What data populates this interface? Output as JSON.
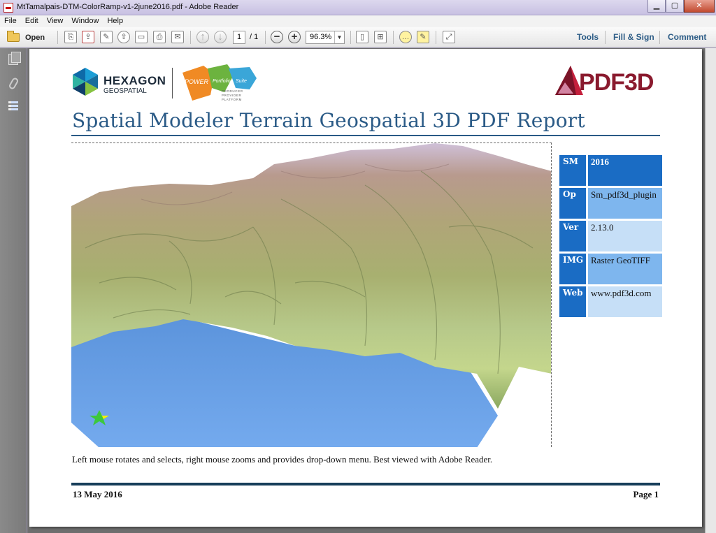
{
  "window": {
    "title": "MtTamalpais-DTM-ColorRamp-v1-2june2016.pdf - Adobe Reader",
    "minimize": "▁",
    "maximize": "▢",
    "close": "✕"
  },
  "menu": [
    "File",
    "Edit",
    "View",
    "Window",
    "Help"
  ],
  "toolbar": {
    "open_label": "Open",
    "page_current": "1",
    "page_total": "/ 1",
    "zoom_value": "96.3%",
    "zoom_arrow": "▼",
    "zoom_out": "−",
    "zoom_in": "+",
    "tools": "Tools",
    "fill_sign": "Fill & Sign",
    "comment": "Comment"
  },
  "logos": {
    "hexagon_word": "HEXAGON",
    "hexagon_sub": "GEOSPATIAL",
    "power_word": "POWER",
    "portfolio_word": "Portfolio",
    "suite_word": "Suite",
    "power_sub": [
      "PRODUCER",
      "PROVIDER",
      "PLATFORM"
    ],
    "pdf3d_word": "PDF3D"
  },
  "report": {
    "title": "Spatial Modeler Terrain Geospatial 3D PDF Report",
    "instructions": "Left mouse rotates and selects, right mouse zooms and provides drop-down menu. Best viewed with Adobe Reader.",
    "date": "13 May 2016",
    "page_label": "Page 1"
  },
  "info_table": [
    {
      "key": "SM",
      "value": "2016"
    },
    {
      "key": "Op",
      "value": "Sm_pdf3d_plugin"
    },
    {
      "key": "Ver",
      "value": "2.13.0"
    },
    {
      "key": "IMG",
      "value": "Raster GeoTIFF"
    },
    {
      "key": "Web",
      "value": "www.pdf3d.com"
    }
  ],
  "colors": {
    "title_blue": "#2a5a86",
    "table_dark": "#1a6cc4",
    "table_mid": "#7eb6ee",
    "table_light": "#c6dff7",
    "pdf3d_red": "#8a1a2e",
    "water": "#6ea4e8"
  }
}
